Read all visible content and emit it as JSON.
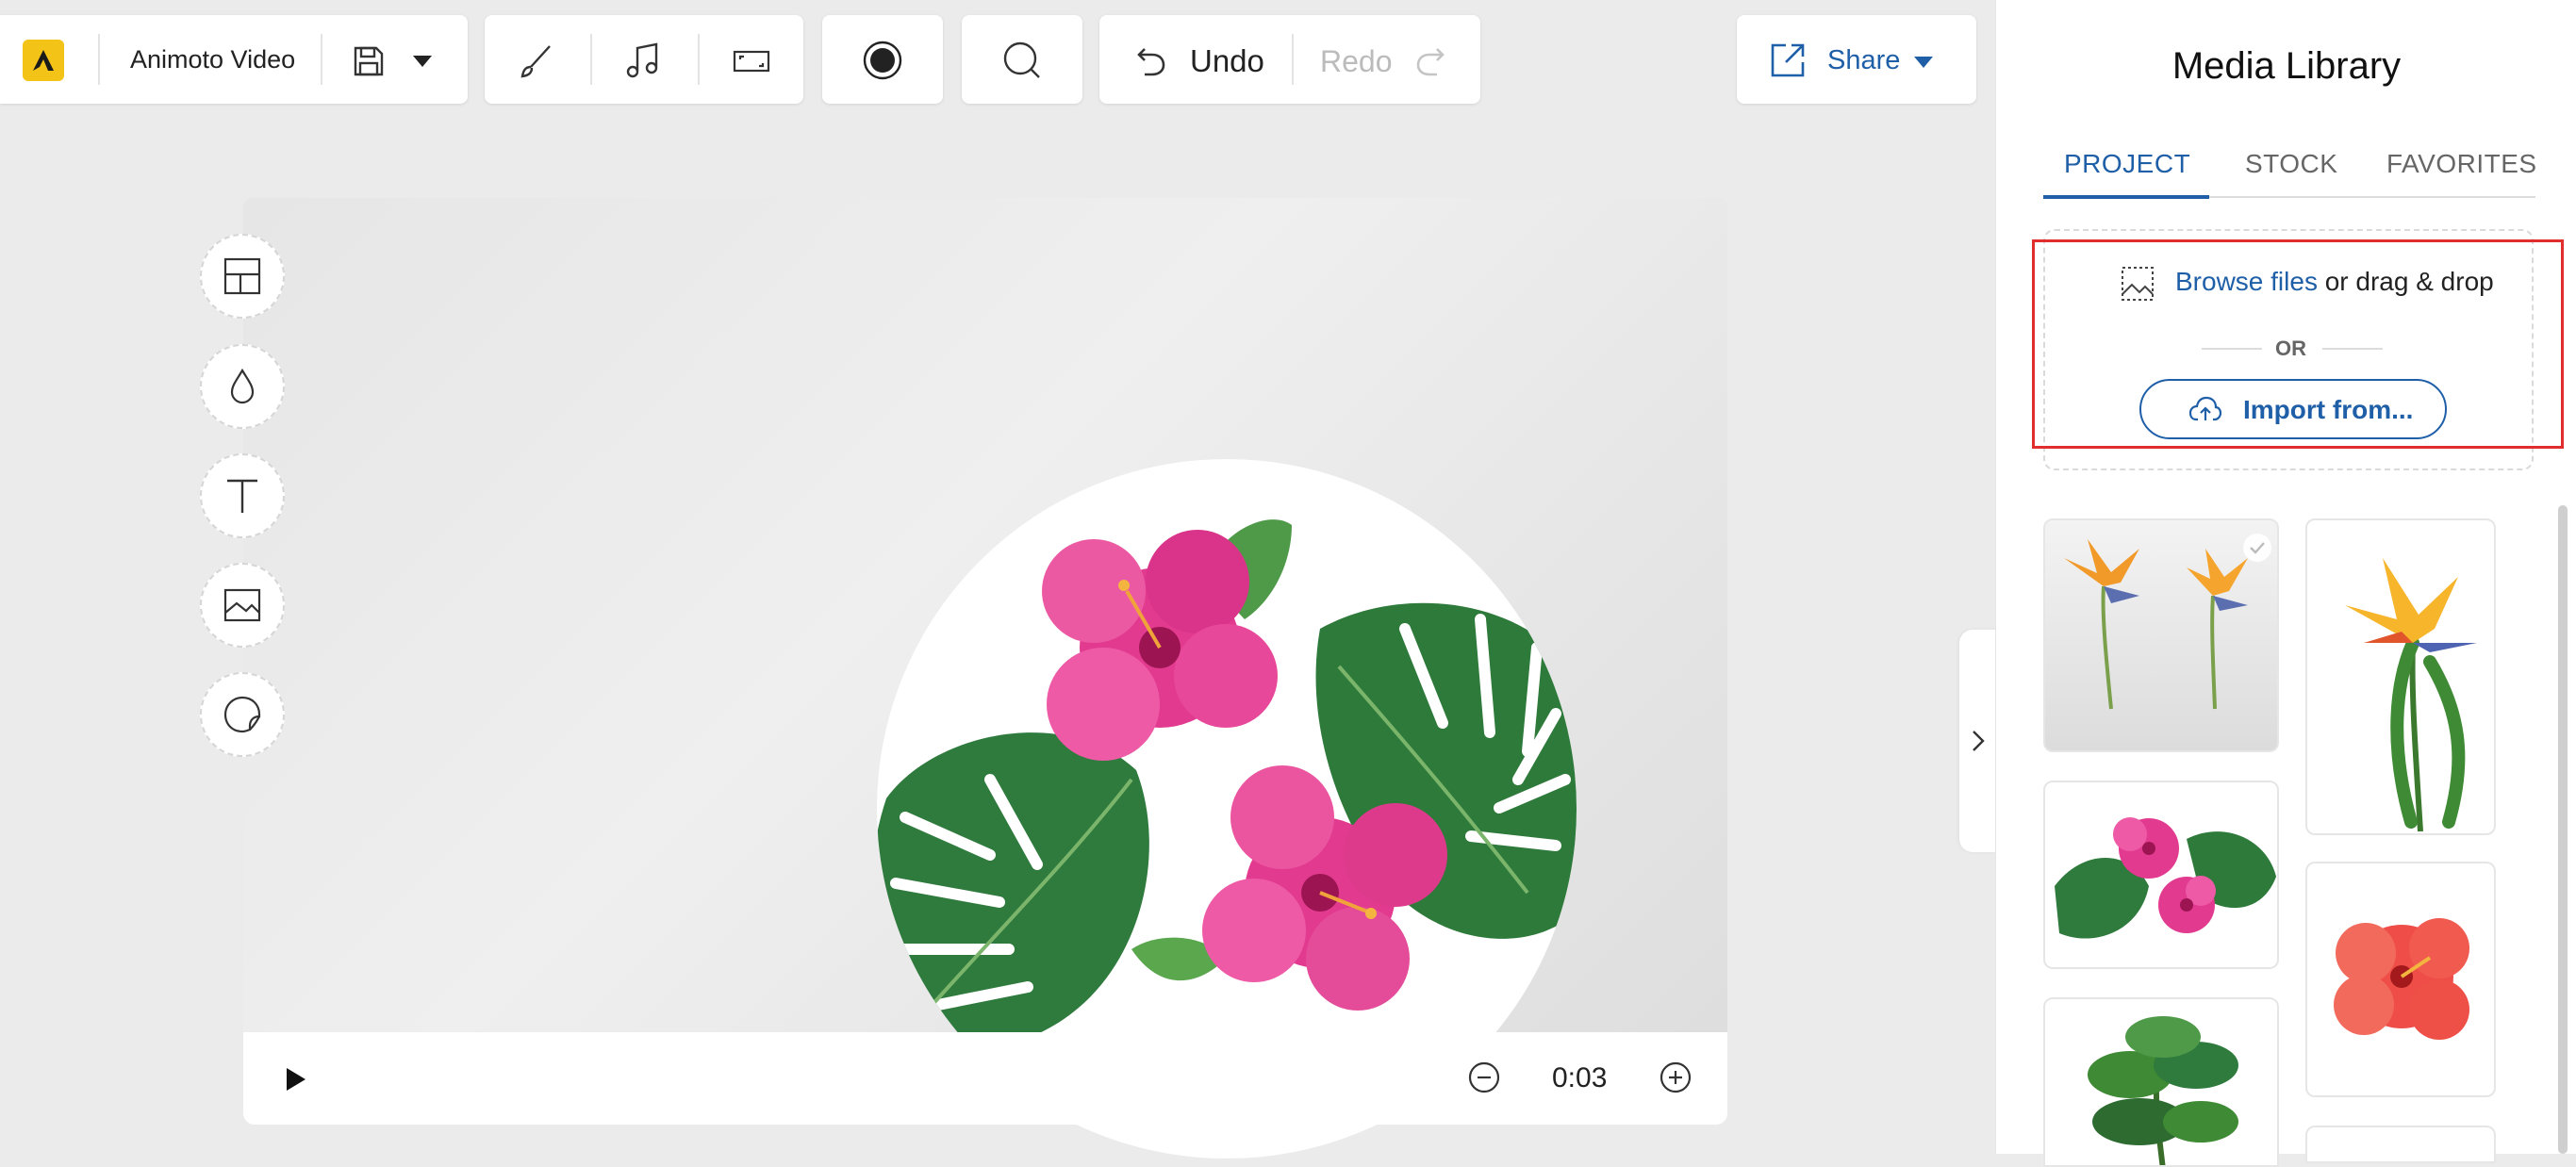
{
  "toolbar": {
    "app_name": "Animoto Video",
    "undo_label": "Undo",
    "redo_label": "Redo",
    "share_label": "Share"
  },
  "player": {
    "time": "0:03"
  },
  "media_library": {
    "title": "Media Library",
    "tabs": [
      {
        "label": "PROJECT",
        "active": true
      },
      {
        "label": "STOCK",
        "active": false
      },
      {
        "label": "FAVORITES",
        "active": false
      }
    ],
    "upload": {
      "browse_link": "Browse files",
      "drag_text": "or drag & drop",
      "or_label": "OR",
      "import_label": "Import from..."
    },
    "thumbnails": [
      "birds-of-paradise-pair",
      "bird-of-paradise-single",
      "hibiscus-monstera-arrangement",
      "red-hibiscus",
      "tropical-plant-bunch"
    ]
  },
  "colors": {
    "accent_blue": "#1f5fa8",
    "logo_yellow": "#f3c318",
    "highlight_red": "#e02d2d",
    "hibiscus_pink": "#e13a8f",
    "leaf_green": "#2f7a3d"
  }
}
